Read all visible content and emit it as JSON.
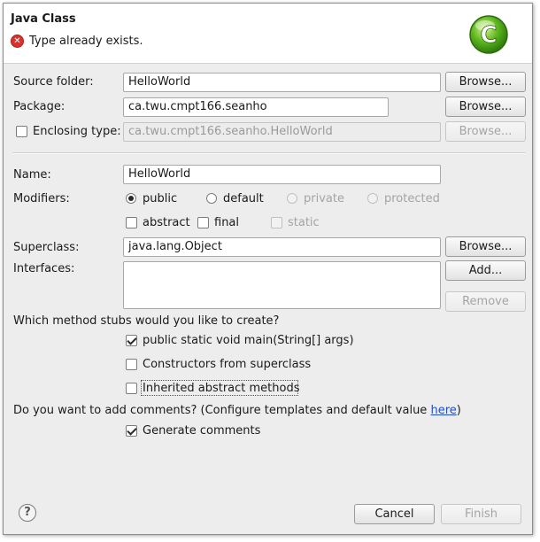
{
  "header": {
    "title": "Java Class",
    "error_text": "Type already exists.",
    "error_icon": "error-x-icon",
    "logo_icon": "new-class-wizard-icon",
    "logo_letter": "C"
  },
  "form": {
    "source_folder_label": "Source folder:",
    "source_folder_value": "HelloWorld",
    "package_label": "Package:",
    "package_value": "ca.twu.cmpt166.seanho",
    "enclosing_label": "Enclosing type:",
    "enclosing_value": "ca.twu.cmpt166.seanho.HelloWorld",
    "name_label": "Name:",
    "name_value": "HelloWorld",
    "modifiers_label": "Modifiers:",
    "mod_public": "public",
    "mod_default": "default",
    "mod_private": "private",
    "mod_protected": "protected",
    "mod_abstract": "abstract",
    "mod_final": "final",
    "mod_static": "static",
    "superclass_label": "Superclass:",
    "superclass_value": "java.lang.Object",
    "interfaces_label": "Interfaces:",
    "stubs_question": "Which method stubs would you like to create?",
    "stub_main": "public static void main(String[] args)",
    "stub_constructors": "Constructors from superclass",
    "stub_inherited": "Inherited abstract methods",
    "comments_question_prefix": "Do you want to add comments? (Configure templates and default value ",
    "comments_link": "here",
    "comments_question_suffix": ")",
    "generate_comments": "Generate comments"
  },
  "buttons": {
    "browse": "Browse...",
    "add": "Add...",
    "remove": "Remove",
    "cancel": "Cancel",
    "finish": "Finish",
    "help_icon": "help-icon",
    "help_glyph": "?"
  }
}
